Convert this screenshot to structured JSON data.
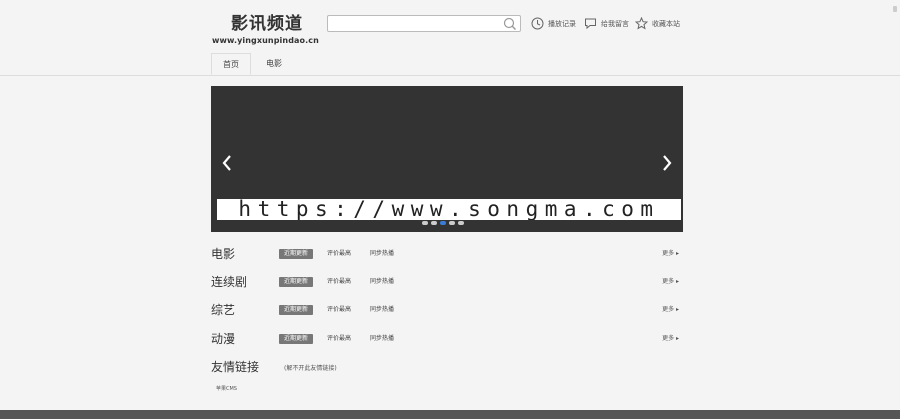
{
  "header": {
    "logo_cn": "影讯频道",
    "logo_url": "www.yingxunpindao.cn",
    "search_placeholder": "",
    "links": [
      "播放记录",
      "给我留言",
      "收藏本站"
    ]
  },
  "tabs": [
    "首页",
    "电影"
  ],
  "banner": {
    "watermark": "https://www.songma.com",
    "slide_count": 5,
    "active_slide": 2
  },
  "categories": [
    {
      "title": "电影",
      "tabs": [
        "近期更新",
        "评价最高",
        "同步热播"
      ],
      "more": "更多"
    },
    {
      "title": "连续剧",
      "tabs": [
        "近期更新",
        "评价最高",
        "同步热播"
      ],
      "more": "更多"
    },
    {
      "title": "综艺",
      "tabs": [
        "近期更新",
        "评价最高",
        "同步热播"
      ],
      "more": "更多"
    },
    {
      "title": "动漫",
      "tabs": [
        "近期更新",
        "评价最高",
        "同步热播"
      ],
      "more": "更多"
    }
  ],
  "friends": {
    "title": "友情链接",
    "hint": "(解不开此友情链接)",
    "links": [
      "苹果CMS"
    ]
  }
}
